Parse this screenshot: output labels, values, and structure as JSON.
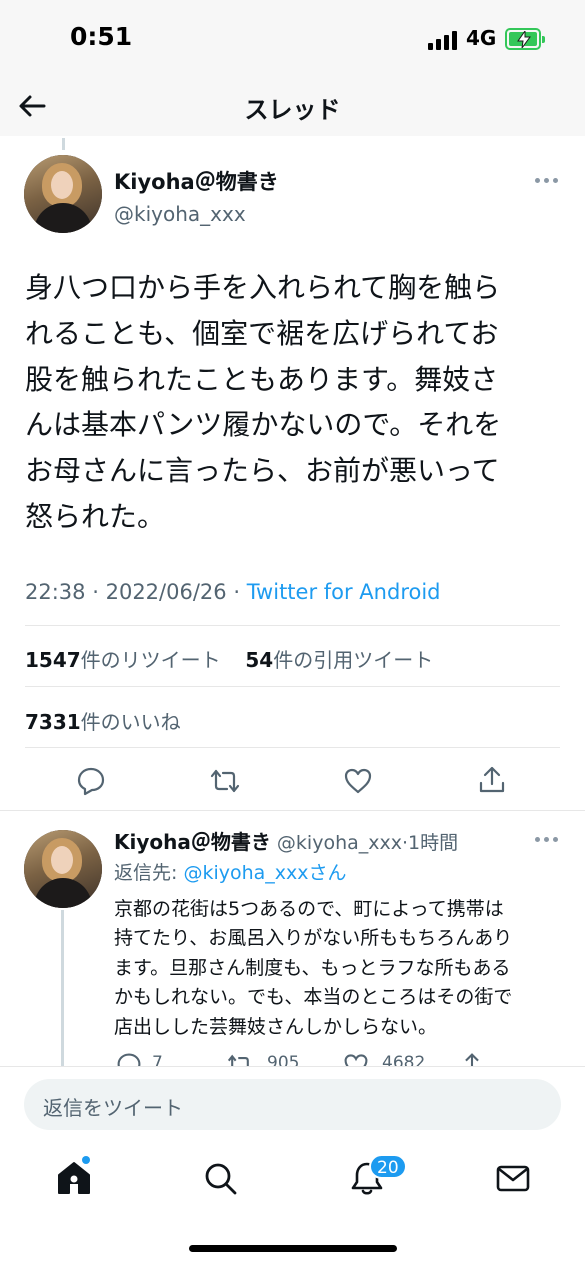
{
  "status_bar": {
    "time": "0:51",
    "network": "4G"
  },
  "nav": {
    "title": "スレッド"
  },
  "main_tweet": {
    "author_name": "Kiyoha＠物書き",
    "author_handle": "@kiyoha_xxx",
    "text_lines": [
      "身八つ口から手を入れられて胸を触ら",
      "れることも、個室で裾を広げられてお",
      "股を触られたこともあります。舞妓さ",
      "んは基本パンツ履かないので。それを",
      "お母さんに言ったら、お前が悪いって",
      "怒られた。"
    ],
    "time": "22:38",
    "date": "2022/06/26",
    "separator": "·",
    "source": "Twitter for Android",
    "retweets_count": "1547",
    "retweets_label": "件のリツイート",
    "quotes_count": "54",
    "quotes_label": "件の引用ツイート",
    "likes_count": "7331",
    "likes_label": "件のいいね"
  },
  "reply_tweet": {
    "author_name": "Kiyoha＠物書き",
    "author_handle": "@kiyoha_xxx",
    "time_ago": "·1時間",
    "reply_to_prefix": "返信先: ",
    "reply_to_handle": "@kiyoha_xxxさん",
    "text_lines": [
      "京都の花街は5つあるので、町によって携帯は",
      "持てたり、お風呂入りがない所ももちろんあり",
      "ます。旦那さん制度も、もっとラフな所もある",
      "かもしれない。でも、本当のところはその街で",
      "店出しした芸舞妓さんしかしらない。"
    ],
    "reply_count": "7",
    "retweet_count": "905",
    "like_count": "4682"
  },
  "compose": {
    "placeholder": "返信をツイート"
  },
  "tab_bar": {
    "notifications_badge": "20"
  },
  "colors": {
    "accent": "#1d9bf0",
    "secondary_text": "#536471",
    "battery": "#34c759"
  }
}
